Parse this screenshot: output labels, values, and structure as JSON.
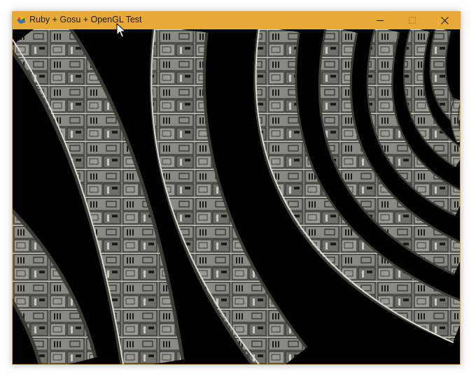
{
  "window": {
    "title": "Ruby + Gosu + OpenGL Test",
    "accent_color": "#e8a935",
    "controls": {
      "minimize_icon": "minimize-icon",
      "maximize_icon": "maximize-icon",
      "close_icon": "close-icon"
    }
  },
  "scene": {
    "background_color": "#000000",
    "object": "metal-panel-tunnel-rings"
  }
}
